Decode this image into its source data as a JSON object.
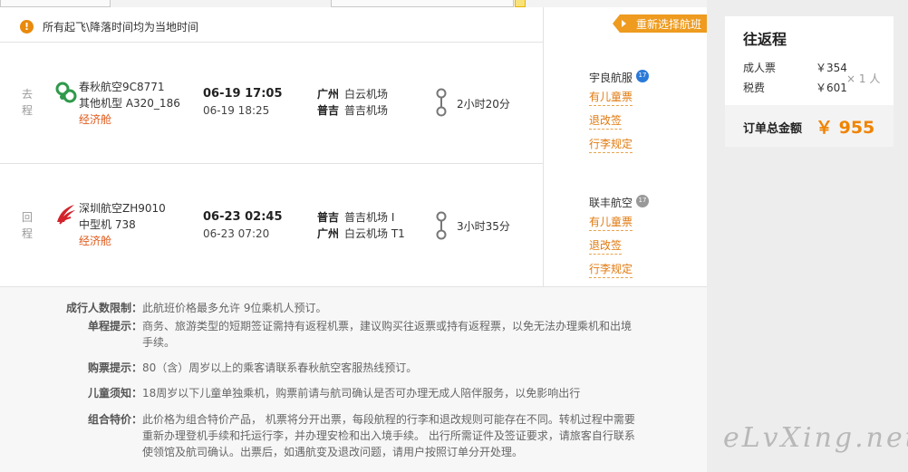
{
  "notice": {
    "icon": "warning-icon",
    "text": "所有起飞\\降落时间均为当地时间"
  },
  "rebook_button": "重新选择航班",
  "segments": [
    {
      "label": "去程",
      "airline": "春秋航空9C8771",
      "aircraft": "其他机型 A320_186",
      "cabin": "经济舱",
      "dep_time": "06-19 17:05",
      "arr_time": "06-19 18:25",
      "from_city": "广州",
      "from_airport": "白云机场",
      "to_city": "普吉",
      "to_airport": "普吉机场",
      "duration": "2小时20分",
      "operator": "宇良航服",
      "badge": "17",
      "links": [
        "有儿童票",
        "退改签",
        "行李规定"
      ]
    },
    {
      "label": "回程",
      "airline": "深圳航空ZH9010",
      "aircraft": "中型机 738",
      "cabin": "经济舱",
      "dep_time": "06-23 02:45",
      "arr_time": "06-23 07:20",
      "from_city": "普吉",
      "from_airport": "普吉机场 I",
      "to_city": "广州",
      "to_airport": "白云机场 T1",
      "duration": "3小时35分",
      "operator": "联丰航空",
      "badge": "17",
      "links": [
        "有儿童票",
        "退改签",
        "行李规定"
      ]
    }
  ],
  "info": [
    {
      "k": "成行人数限制：",
      "v": "此航班价格最多允许 9位乘机人预订。"
    },
    {
      "k": "单程提示：",
      "v": "商务、旅游类型的短期签证需持有返程机票，建议购买往返票或持有返程票，以免无法办理乘机和出境手续。"
    },
    {
      "k": "购票提示：",
      "v": "80（含）周岁以上的乘客请联系春秋航空客服热线预订。"
    },
    {
      "k": "儿童须知：",
      "v": "18周岁以下儿童单独乘机，购票前请与航司确认是否可办理无成人陪伴服务，以免影响出行"
    },
    {
      "k": "组合特价：",
      "v": "此价格为组合特价产品， 机票将分开出票，每段航程的行李和退改规则可能存在不同。转机过程中需要重新办理登机手续和托运行李，并办理安检和出入境手续。 出行所需证件及签证要求，请旅客自行联系使领馆及航司确认。出票后，如遇航变及退改问题，请用户按照订单分开处理。"
    }
  ],
  "price": {
    "title": "往返程",
    "adult_label": "成人票",
    "adult_value": "￥354",
    "tax_label": "税费",
    "tax_value": "￥601",
    "multiplier": "× 1 人",
    "total_label": "订单总金额",
    "total_value": "￥ 955"
  },
  "watermark": "eLvXing.net",
  "colors": {
    "accent": "#f08300",
    "link": "#e07a10",
    "warning": "#e98a0c",
    "badge": "#2a7ad8"
  }
}
